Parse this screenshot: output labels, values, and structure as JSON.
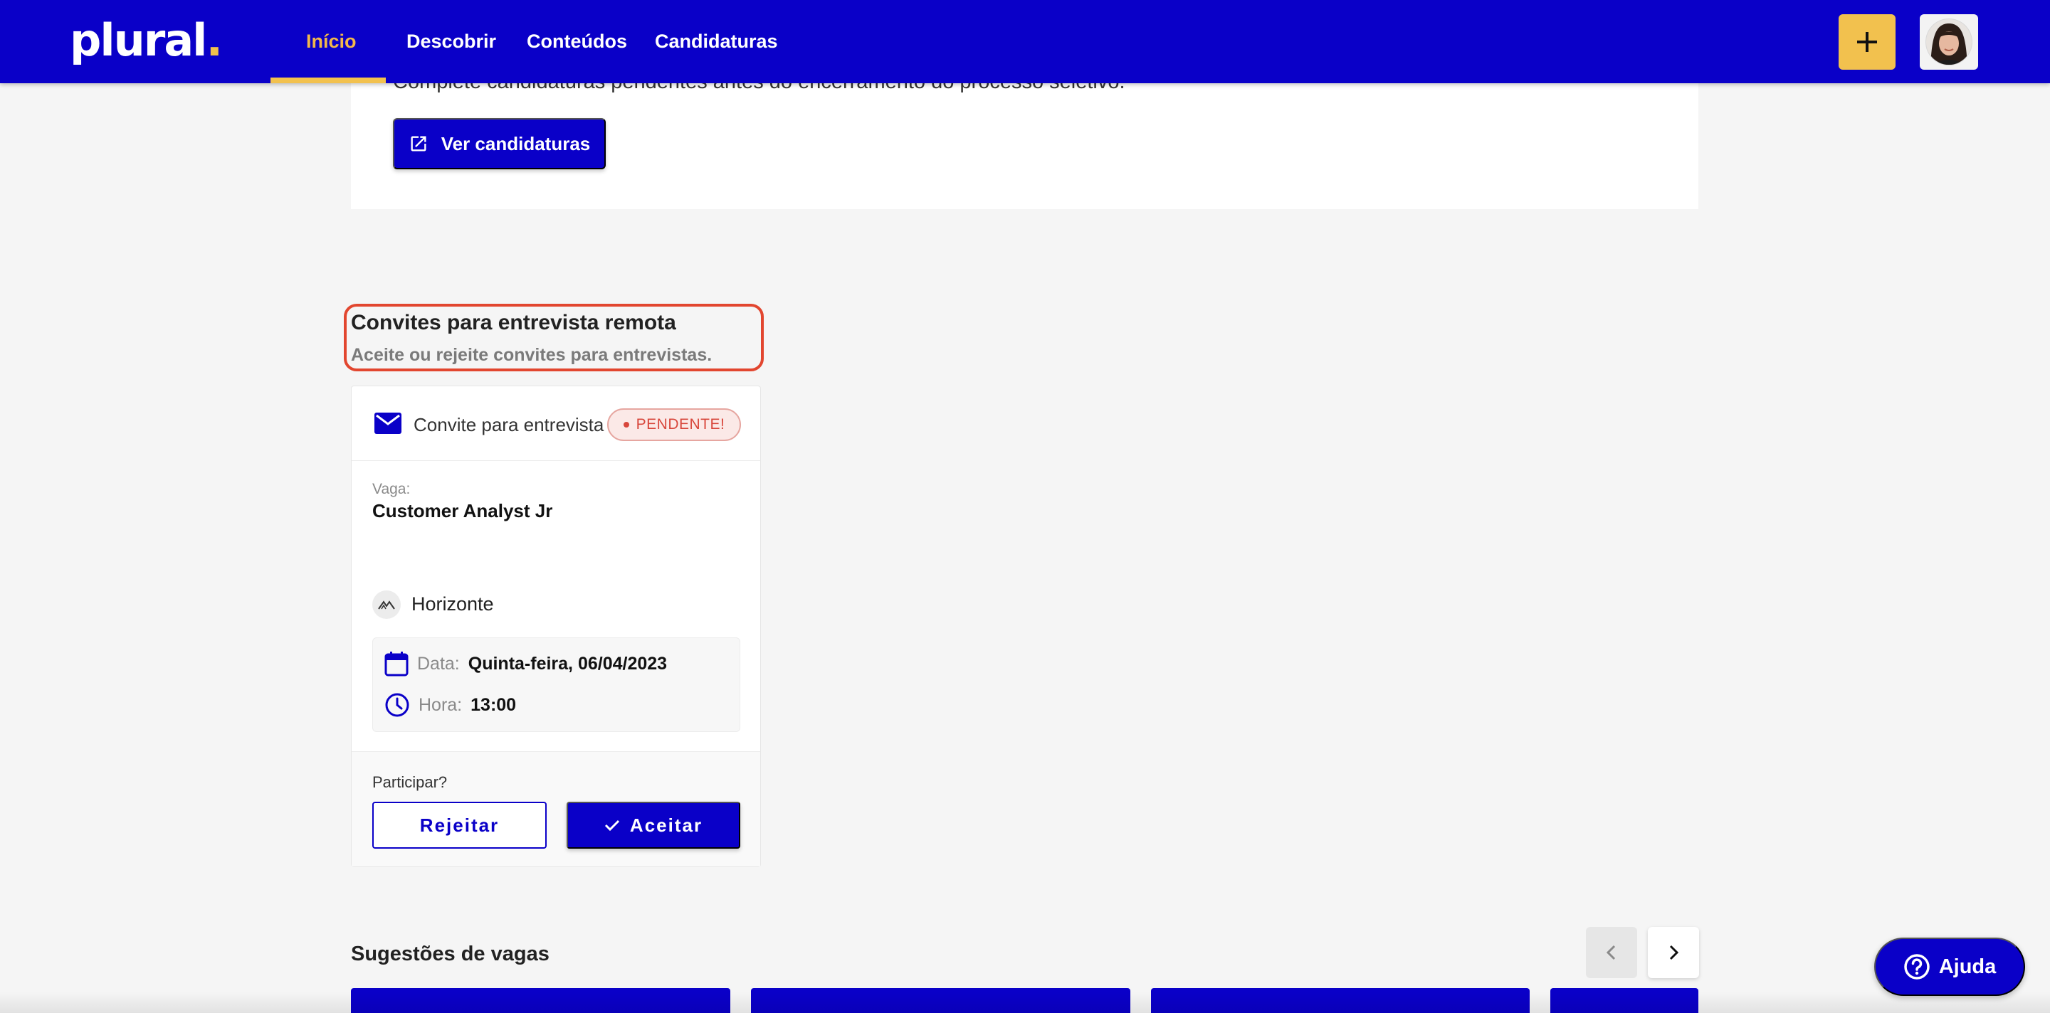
{
  "app": {
    "logo_text": "plural"
  },
  "nav": {
    "items": [
      {
        "label": "Início",
        "active": true
      },
      {
        "label": "Descobrir",
        "active": false
      },
      {
        "label": "Conteúdos",
        "active": false
      },
      {
        "label": "Candidaturas",
        "active": false
      }
    ],
    "plus_icon": "plus-icon",
    "avatar_icon": "user-avatar"
  },
  "applications_card": {
    "text": "Complete candidaturas pendentes antes do encerramento do processo seletivo.",
    "button_label": "Ver candidaturas",
    "button_icon": "external-link-icon"
  },
  "invites_section": {
    "title": "Convites para entrevista remota",
    "subtitle": "Aceite ou rejeite convites para entrevistas.",
    "invite": {
      "header_title": "Convite para entrevista",
      "header_icon": "mail-icon",
      "status_badge": "PENDENTE!",
      "vaga_label": "Vaga:",
      "vaga_title": "Customer Analyst Jr",
      "company_name": "Horizonte",
      "date_label": "Data:",
      "date_value": "Quinta-feira, 06/04/2023",
      "time_label": "Hora:",
      "time_value": "13:00",
      "question": "Participar?",
      "reject_label": "Rejeitar",
      "accept_label": "Aceitar"
    }
  },
  "suggestions": {
    "title": "Sugestões de vagas"
  },
  "help": {
    "label": "Ajuda",
    "icon": "help-circle-icon"
  },
  "colors": {
    "primary": "#0a00c8",
    "accent": "#f2c14e",
    "highlight_outline": "#e2462f",
    "pending": "#d8473c"
  }
}
